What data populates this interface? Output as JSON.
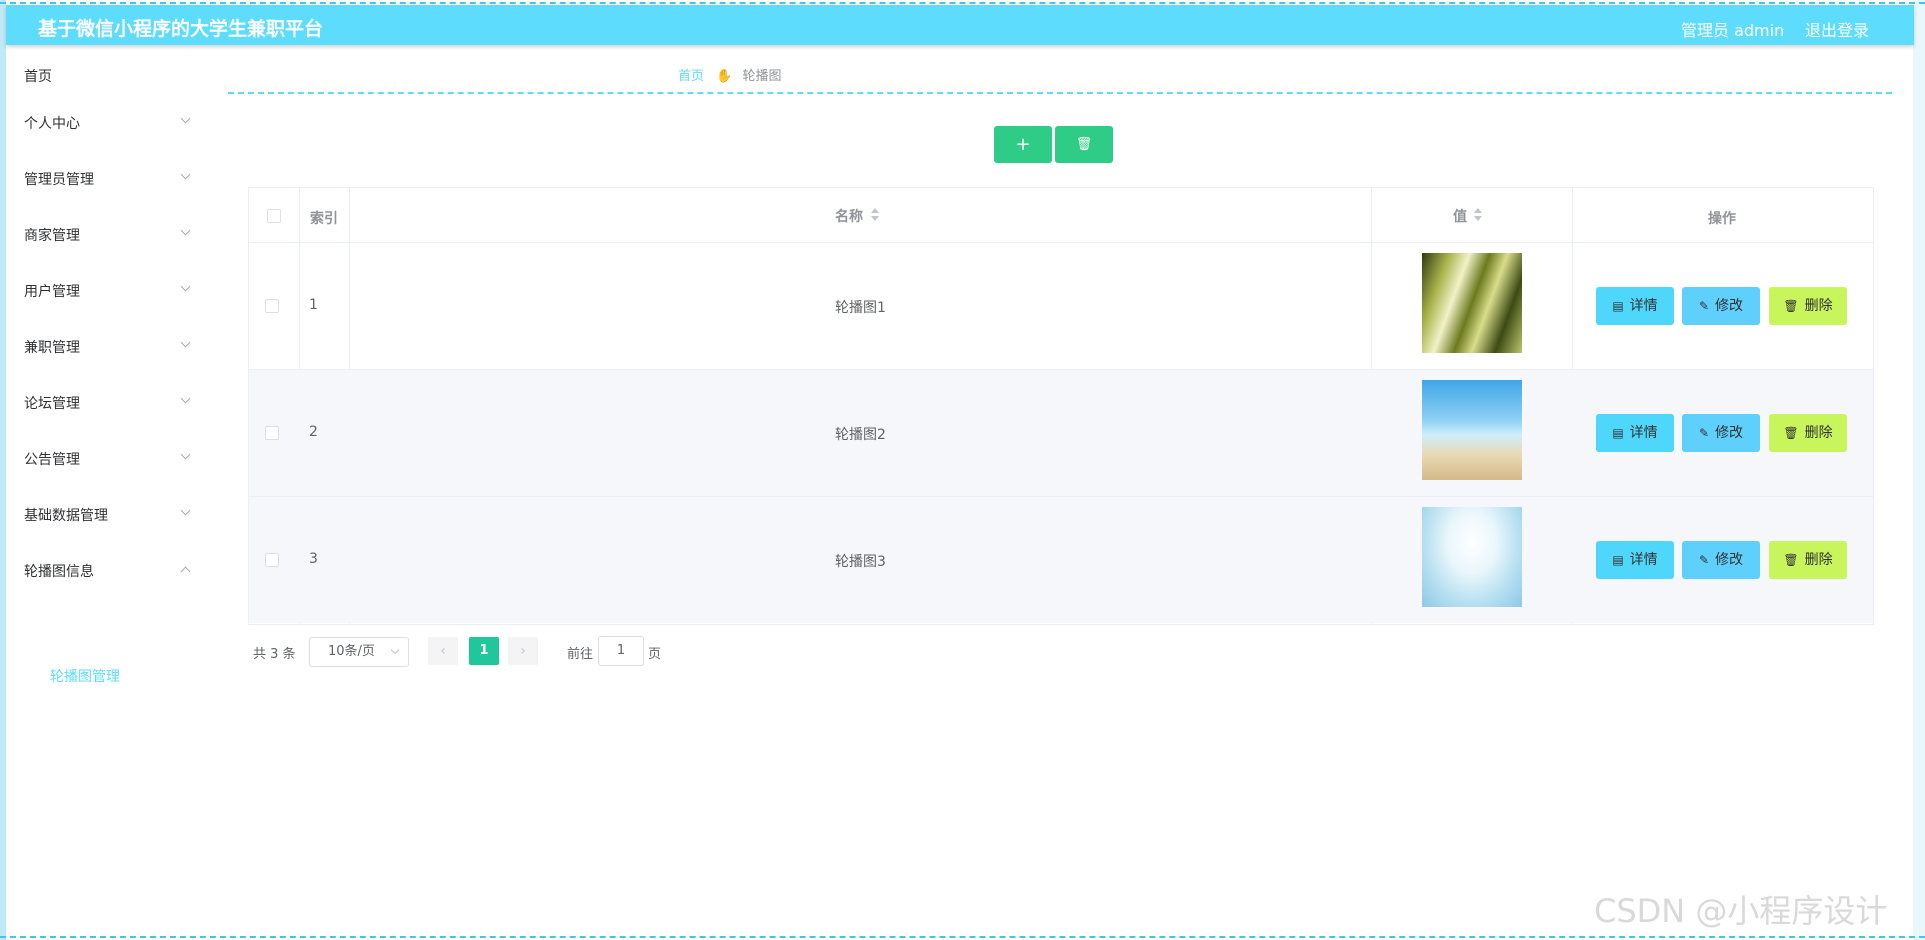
{
  "header": {
    "title": "基于微信小程序的大学生兼职平台",
    "user": "管理员 admin",
    "logout": "退出登录"
  },
  "sidebar": {
    "items": [
      {
        "label": "首页"
      },
      {
        "label": "个人中心"
      },
      {
        "label": "管理员管理"
      },
      {
        "label": "商家管理"
      },
      {
        "label": "用户管理"
      },
      {
        "label": "兼职管理"
      },
      {
        "label": "论坛管理"
      },
      {
        "label": "公告管理"
      },
      {
        "label": "基础数据管理"
      },
      {
        "label": "轮播图信息"
      }
    ],
    "sub_item": "轮播图管理"
  },
  "breadcrumb": {
    "home": "首页",
    "current": "轮播图"
  },
  "toolbar": {
    "add_icon": "+",
    "delete_icon": "🗑"
  },
  "table": {
    "headers": {
      "index": "索引",
      "name": "名称",
      "value": "值",
      "ops": "操作"
    },
    "rows": [
      {
        "index": "1",
        "name": "轮播图1"
      },
      {
        "index": "2",
        "name": "轮播图2"
      },
      {
        "index": "3",
        "name": "轮播图3"
      }
    ],
    "ops": {
      "detail": "详情",
      "edit": "修改",
      "delete": "删除"
    }
  },
  "pagination": {
    "total": "共 3 条",
    "page_size": "10条/页",
    "current": "1",
    "goto_label": "前往",
    "goto_value": "1",
    "unit": "页"
  },
  "watermark": "CSDN @小程序设计",
  "colors": {
    "accent": "#5ddcfd",
    "primary_green": "#2ecc86",
    "pager_active": "#1fc79a",
    "delete_btn": "#c8f45c"
  }
}
